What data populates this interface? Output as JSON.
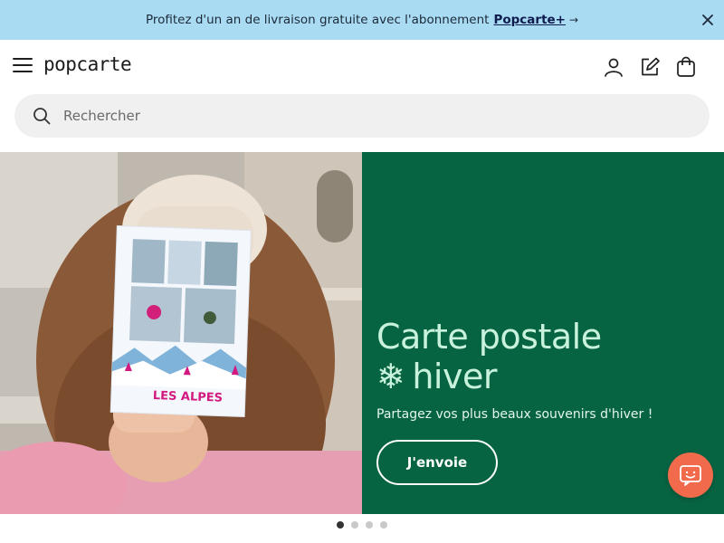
{
  "promo": {
    "text": "Profitez d'un an de livraison gratuite avec l'abonnement",
    "link": "Popcarte+",
    "arrow": "→"
  },
  "header": {
    "logo": "popcarte"
  },
  "search": {
    "placeholder": "Rechercher"
  },
  "hero": {
    "title_line1": "Carte postale",
    "title_snow": "❄",
    "title_line2": "hiver",
    "subtitle": "Partagez vos plus beaux souvenirs d'hiver !",
    "cta": "J'envoie",
    "card_caption": "LES ALPES"
  },
  "carousel": {
    "slides": 4,
    "active": 1
  },
  "colors": {
    "promo_bg": "#a9dbf2",
    "hero_panel": "#076443",
    "hero_title": "#c9f2dd",
    "chat_button": "#f06a4b",
    "card_caption": "#d2197f"
  }
}
